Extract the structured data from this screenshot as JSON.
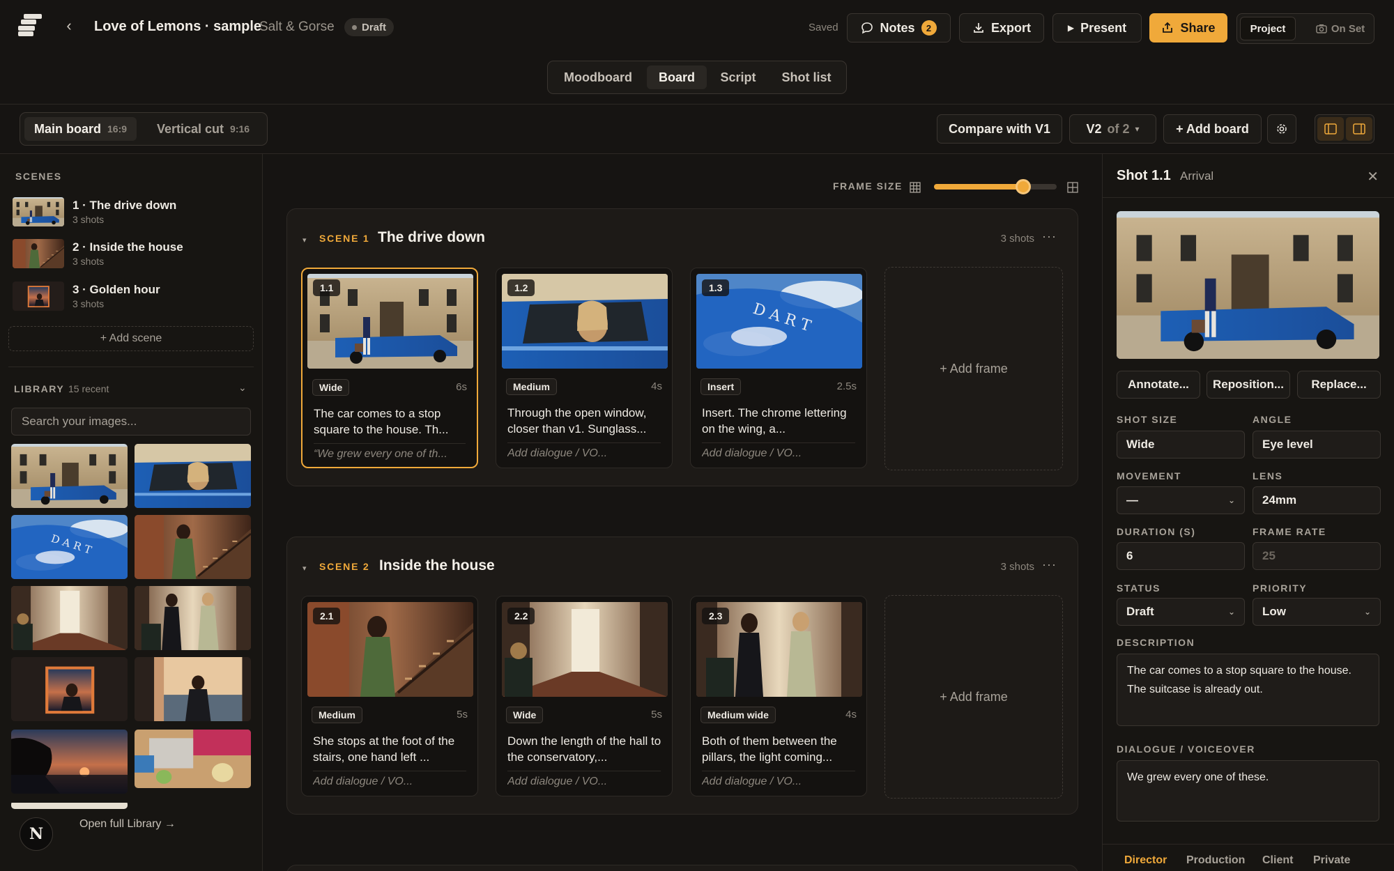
{
  "header": {
    "title": "Love of Lemons · sample",
    "client": "Salt & Gorse",
    "status": "Draft",
    "saved_label": "Saved",
    "notes_label": "Notes",
    "notes_count": "2",
    "export_label": "Export",
    "present_label": "Present",
    "share_label": "Share",
    "mode_project": "Project",
    "mode_onset": "On Set"
  },
  "tabs": [
    "Moodboard",
    "Board",
    "Script",
    "Shot list"
  ],
  "active_tab": "Board",
  "boardbar": {
    "boards": [
      {
        "name": "Main board",
        "ratio": "16:9"
      },
      {
        "name": "Vertical cut",
        "ratio": "9:16"
      }
    ],
    "compare_label": "Compare with V1",
    "version": "V2",
    "version_of": "of 2",
    "add_board_label": "+ Add board"
  },
  "sidebar": {
    "scenes_label": "SCENES",
    "scenes": [
      {
        "name": "1 · The drive down",
        "count": "3 shots"
      },
      {
        "name": "2 · Inside the house",
        "count": "3 shots"
      },
      {
        "name": "3 · Golden hour",
        "count": "3 shots"
      }
    ],
    "add_scene_label": "+ Add scene",
    "library_label": "LIBRARY",
    "library_count": "15 recent",
    "search_placeholder": "Search your images...",
    "open_library_label": "Open full Library →",
    "avatar_letter": "N"
  },
  "main": {
    "frame_size_label": "FRAME SIZE",
    "frame_size_value": 0.73,
    "add_frame_label": "+ Add frame",
    "scenes": [
      {
        "tag": "SCENE 1",
        "title": "The drive down",
        "count": "3 shots",
        "frames": [
          {
            "num": "1.1",
            "size": "Wide",
            "duration": "6s",
            "description": "The car comes to a stop square to the house. Th...",
            "dialogue": "“We grew every one of th..."
          },
          {
            "num": "1.2",
            "size": "Medium",
            "duration": "4s",
            "description": "Through the open window, closer than v1. Sunglass...",
            "dialogue": "Add dialogue / VO..."
          },
          {
            "num": "1.3",
            "size": "Insert",
            "duration": "2.5s",
            "description": "Insert. The chrome lettering on the wing, a...",
            "dialogue": "Add dialogue / VO..."
          }
        ]
      },
      {
        "tag": "SCENE 2",
        "title": "Inside the house",
        "count": "3 shots",
        "frames": [
          {
            "num": "2.1",
            "size": "Medium",
            "duration": "5s",
            "description": "She stops at the foot of the stairs, one hand left ...",
            "dialogue": "Add dialogue / VO..."
          },
          {
            "num": "2.2",
            "size": "Wide",
            "duration": "5s",
            "description": "Down the length of the hall to the conservatory,...",
            "dialogue": "Add dialogue / VO..."
          },
          {
            "num": "2.3",
            "size": "Medium wide",
            "duration": "4s",
            "description": "Both of them between the pillars, the light coming...",
            "dialogue": "Add dialogue / VO..."
          }
        ]
      }
    ]
  },
  "panel": {
    "title": "Shot 1.1",
    "subtitle": "Arrival",
    "annotate_label": "Annotate...",
    "reposition_label": "Reposition...",
    "replace_label": "Replace...",
    "fields": {
      "shot_size_label": "SHOT SIZE",
      "shot_size": "Wide",
      "angle_label": "ANGLE",
      "angle": "Eye level",
      "movement_label": "MOVEMENT",
      "movement": "—",
      "lens_label": "LENS",
      "lens": "24mm",
      "duration_label": "DURATION (S)",
      "duration": "6",
      "frame_rate_label": "FRAME RATE",
      "frame_rate": "25",
      "status_label": "STATUS",
      "status": "Draft",
      "priority_label": "PRIORITY",
      "priority": "Low"
    },
    "description_label": "DESCRIPTION",
    "description": "The car comes to a stop square to the house. The suitcase is already out.",
    "dialogue_label": "DIALOGUE / VOICEOVER",
    "dialogue": "We grew every one of these.",
    "footer_tabs": [
      "Director",
      "Production",
      "Client",
      "Private"
    ]
  },
  "colors": {
    "accent": "#f0a93a",
    "background": "#161412",
    "surface": "#1d1a17"
  }
}
